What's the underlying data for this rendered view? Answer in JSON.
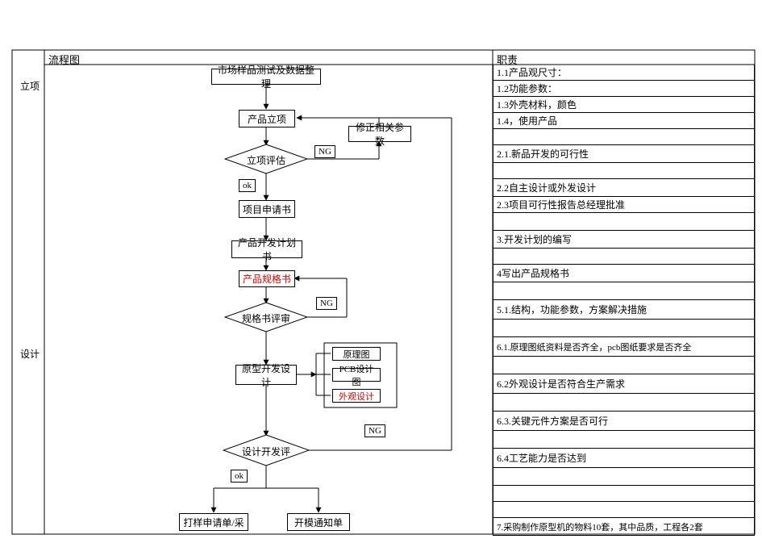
{
  "headers": {
    "flow": "流程图",
    "duties": "职责"
  },
  "phases": {
    "p1": "立项",
    "p2": "设计"
  },
  "nodes": {
    "n_market": "市场样品测试及数据整理",
    "n_lixiang": "产品立项",
    "n_fixparam": "修正相关参数",
    "d_eval": "立项评估",
    "n_apply": "项目申请书",
    "n_plan": "产品开发计划书",
    "n_spec": "产品规格书",
    "d_specrev": "规格书评审",
    "n_proto": "原型开发设计",
    "n_schem": "原理图",
    "n_pcb": "PCB设计图",
    "n_appear": "外观设计",
    "d_devrev": "设计开发评",
    "n_sample": "打样申请单/采",
    "n_mold": "开模通知单"
  },
  "tags": {
    "ng": "NG",
    "ok": "ok"
  },
  "duties": {
    "r1": "1.1产品观尺寸：",
    "r2": "1.2功能参数：",
    "r3": "1.3外壳材料，颜色",
    "r4": "1.4，使用产品",
    "r5": "",
    "r6": "2.1.新品开发的可行性",
    "r7": "",
    "r8": "2.2自主设计或外发设计",
    "r9": " 2.3项目可行性报告总经理批准",
    "r10": "",
    "r11": "3.开发计划的编写",
    "r12": "",
    "r13": "4写出产品规格书",
    "r14": "",
    "r15": "5.1.结构，功能参数，方案解决措施",
    "r16": "",
    "r17": "6.1.原理图纸资料是否齐全，pcb图纸要求是否齐全",
    "r18": "",
    "r19": "6.2外观设计是否符合生产需求",
    "r20": "",
    "r21": " 6.3.关键元件方案是否可行",
    "r22": "",
    "r23": "6.4工艺能力是否达到",
    "r24": "",
    "r25": "",
    "r26": "",
    "r27": "7.采购制作原型机的物料10套，其中品质，工程各2套"
  }
}
